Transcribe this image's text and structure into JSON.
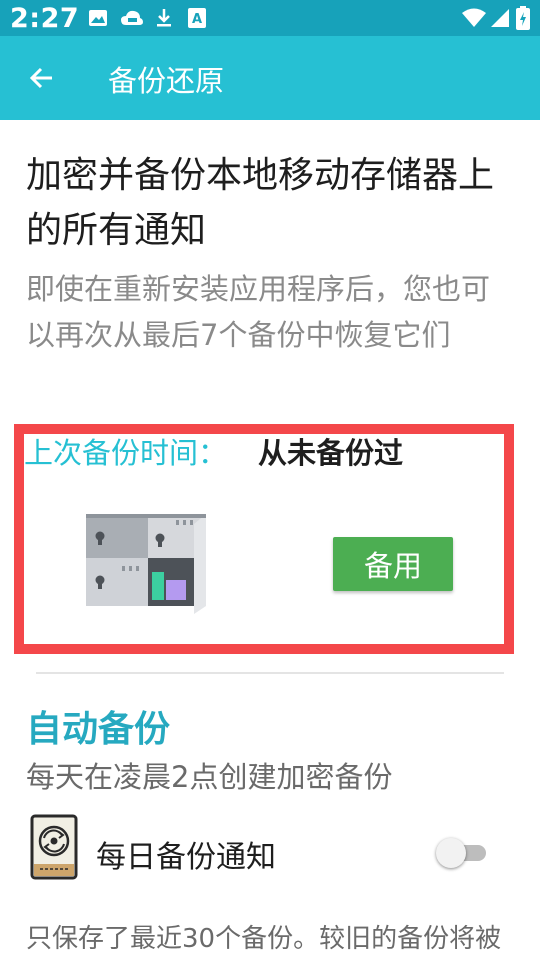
{
  "status_bar": {
    "time": "2:27",
    "left_icons": [
      "image-icon",
      "cloud-icon",
      "download-icon",
      "text-app-icon"
    ],
    "right_icons": [
      "wifi-icon",
      "signal-icon",
      "battery-icon"
    ]
  },
  "app_bar": {
    "back_icon": "arrow-left-icon",
    "title": "备份还原"
  },
  "main": {
    "heading": "加密并备份本地移动存储器上的所有通知",
    "description": "即使在重新安装应用程序后，您也可以再次从最后7个备份中恢复它们"
  },
  "backup_card": {
    "last_backup_label": "上次备份时间：",
    "last_backup_value": "从未备份过",
    "illustration": "safe-locker-icon",
    "backup_button": "备用",
    "highlight_color": "#f4474a",
    "button_color": "#4cae52"
  },
  "auto_backup": {
    "title": "自动备份",
    "description": "每天在凌晨2点创建加密备份",
    "daily_notify_label": "每日备份通知",
    "daily_notify_icon": "disk-sync-icon",
    "daily_notify_enabled": false
  },
  "footer": {
    "text": "只保存了最近30个备份。较旧的备份将被"
  },
  "colors": {
    "status_bar": "#17a2ba",
    "app_bar": "#26c0d3",
    "accent": "#26a9c0"
  }
}
